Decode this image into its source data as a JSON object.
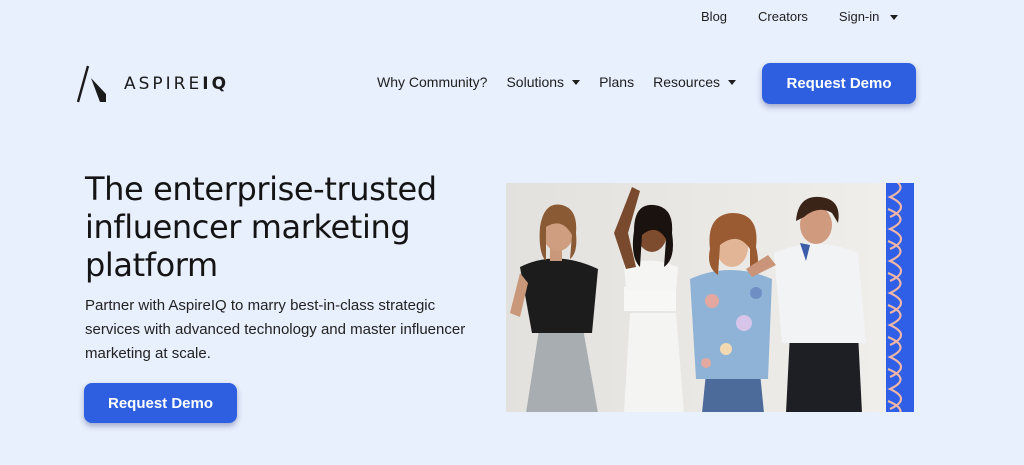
{
  "utility_nav": {
    "blog": "Blog",
    "creators": "Creators",
    "signin": "Sign-in"
  },
  "brand": {
    "name_light": "ASPIRE",
    "name_bold": "IQ"
  },
  "main_nav": {
    "why_community": "Why Community?",
    "solutions": "Solutions",
    "plans": "Plans",
    "resources": "Resources",
    "cta": "Request Demo"
  },
  "hero": {
    "title": "The enterprise-trusted influencer marketing platform",
    "subtitle": "Partner with AspireIQ to marry best-in-class strategic services with advanced technology and master influencer marketing at scale.",
    "cta": "Request Demo"
  },
  "colors": {
    "background": "#e8effd",
    "accent": "#2d5fe0",
    "stripe_wave": "#f0b7a6"
  }
}
